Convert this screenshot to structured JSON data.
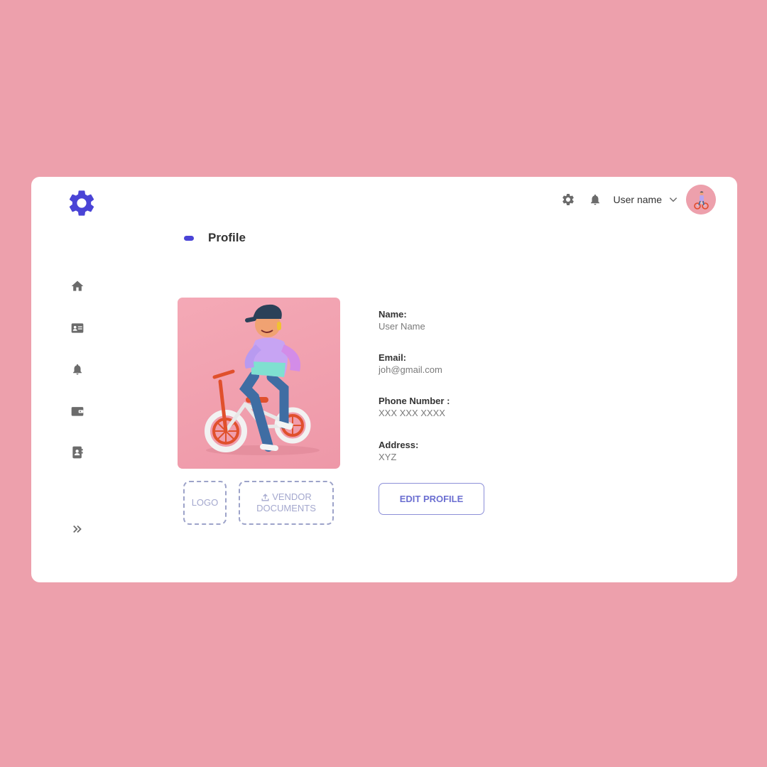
{
  "header": {
    "user_name": "User name"
  },
  "page": {
    "title": "Profile"
  },
  "profile": {
    "name_label": "Name:",
    "name_value": "User Name",
    "email_label": "Email:",
    "email_value": "joh@gmail.com",
    "phone_label": "Phone Number :",
    "phone_value": "XXX XXX XXXX",
    "address_label": "Address:",
    "address_value": "XYZ"
  },
  "actions": {
    "logo_label": "LOGO",
    "vendor_line1": "VENDOR",
    "vendor_line2": "DOCUMENTS",
    "edit_label": "EDIT PROFILE"
  },
  "sidebar": {
    "items": [
      "home-icon",
      "id-card-icon",
      "bell-icon",
      "wallet-icon",
      "contacts-icon",
      "double-chevron-right-icon"
    ]
  },
  "colors": {
    "background": "#eda0ac",
    "accent": "#4a44d6",
    "icon_gray": "#6b6b6b",
    "edit_button": "#6b6fd1"
  }
}
